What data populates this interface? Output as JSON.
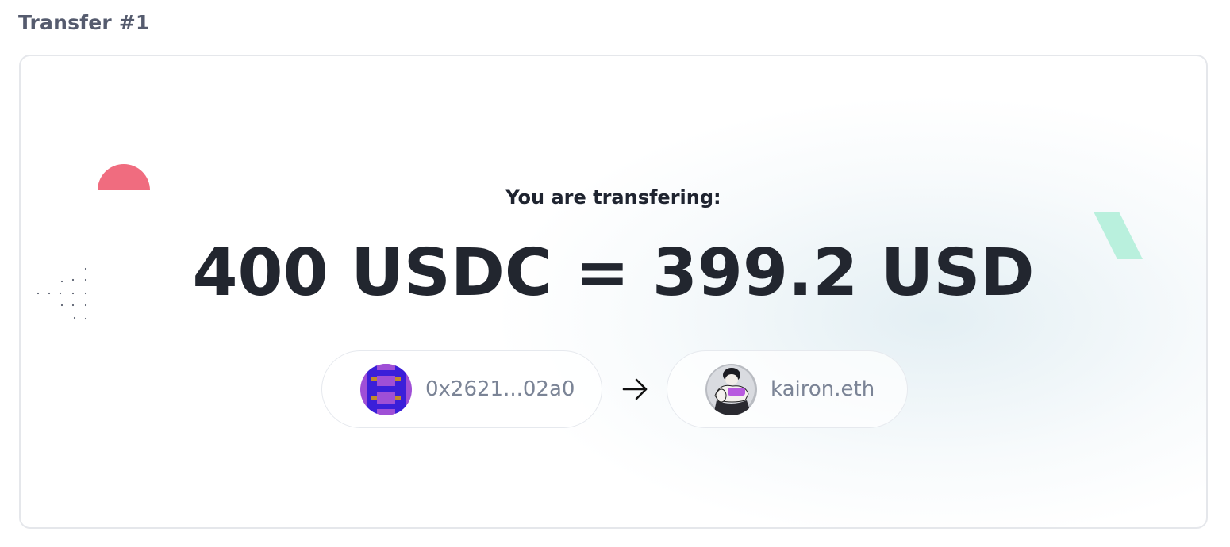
{
  "section": {
    "title": "Transfer #1"
  },
  "transfer": {
    "prompt": "You are transfering:",
    "amount_text": "400 USDC = 399.2 USD",
    "from": {
      "label": "0x2621...02a0",
      "avatar": "pixel-identicon-avatar"
    },
    "to": {
      "label": "kairon.eth",
      "avatar": "profile-photo-avatar"
    },
    "direction_icon": "arrow-right-icon"
  },
  "colors": {
    "title": "#555b6e",
    "amount": "#22262f",
    "party_label": "#7b8496",
    "accent_red": "#f06c7f",
    "accent_mint": "#b9f0dd",
    "identicon_blue": "#3b1fd9",
    "identicon_violet": "#9f4fd6",
    "identicon_gold": "#c28a2b"
  }
}
